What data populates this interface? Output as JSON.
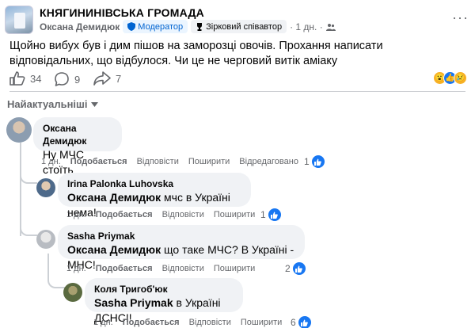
{
  "post": {
    "group_name": "КНЯГИНИНІВСЬКА ГРОМАДА",
    "author": "Оксана Демидюк",
    "badge_moderator": "Модератор",
    "badge_star": "Зірковий співавтор",
    "time": "· 1 дн. ·",
    "text": "Щойно вибух був і дим пішов на заморозці овочів. Прохання написати відповідальних, що відбулося. Чи це не черговий витік аміаку",
    "likes": "34",
    "comments": "9",
    "shares": "7"
  },
  "sort_label": "Найактуальніші",
  "actions": {
    "like": "Подобається",
    "reply": "Відповісти",
    "share": "Поширити",
    "edited": "Відредаговано"
  },
  "comments": [
    {
      "author": "Оксана Демидюк",
      "mention": "",
      "text": "Ну МЧС стоїть",
      "time": "1 дн.",
      "reactions": "1"
    },
    {
      "author": "Irina Palonka Luhovska",
      "mention": "Оксана Демидюк",
      "text": "мчс в Україні нема!",
      "time": "1 дн.",
      "reactions": "1"
    },
    {
      "author": "Sasha Priymak",
      "mention": "Оксана Демидюк",
      "text": "що таке МЧС? В Україні - МНС!",
      "time": "1 дн.",
      "reactions": "2"
    },
    {
      "author": "Коля Тригоб'юк",
      "mention": "Sasha Priymak",
      "text": "в Україні ДСНС!!",
      "time": "1 дн.",
      "reactions": "6"
    }
  ],
  "colors": {
    "link_blue": "#1877f2",
    "bubble": "#f0f2f5",
    "muted": "#65676b"
  }
}
